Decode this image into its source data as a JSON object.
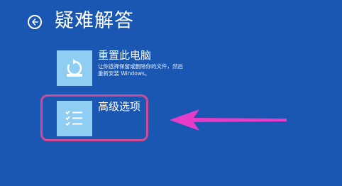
{
  "page": {
    "title": "疑难解答"
  },
  "options": [
    {
      "title": "重置此电脑",
      "description": "让你选择保留或删除你的文件，然后重新安装 Windows。",
      "icon": "reset-pc-icon"
    },
    {
      "title": "高级选项",
      "icon": "checklist-icon"
    }
  ],
  "annotation": {
    "highlight_color": "#d14a93",
    "arrow_color": "#e63cc8"
  },
  "colors": {
    "background": "#1a57b3",
    "tile": "#8fcdf2"
  },
  "icons": {
    "back": "back-arrow-icon"
  }
}
